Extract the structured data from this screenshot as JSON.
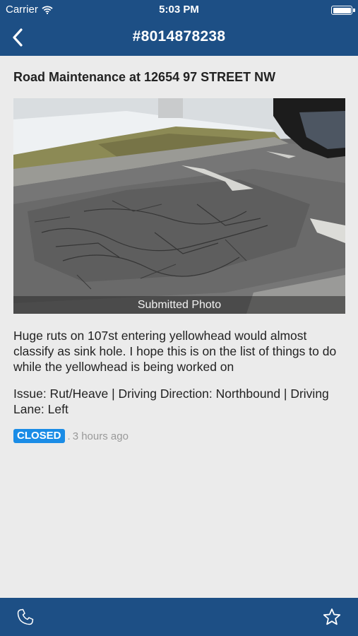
{
  "status_bar": {
    "carrier": "Carrier",
    "time": "5:03 PM",
    "icons": [
      "wifi-icon",
      "battery-icon"
    ]
  },
  "nav": {
    "title": "#8014878238",
    "back_icon": "chevron-left-icon"
  },
  "report": {
    "title": "Road Maintenance at 12654 97 STREET NW",
    "photo_caption": "Submitted Photo",
    "description": "Huge ruts on 107st entering yellowhead would almost classify as sink hole. I hope this is on the list of things to do while the yellowhead is being worked on",
    "issue_details": "Issue: Rut/Heave | Driving Direction: Northbound | Driving Lane: Left",
    "status": "CLOSED",
    "separator": ".",
    "time_ago": "3 hours ago"
  },
  "tab_bar": {
    "left_icon": "phone-icon",
    "right_icon": "star-icon"
  },
  "colors": {
    "nav_background": "#1d4f85",
    "page_background": "#ebebeb",
    "status_badge": "#1a8ce6"
  }
}
